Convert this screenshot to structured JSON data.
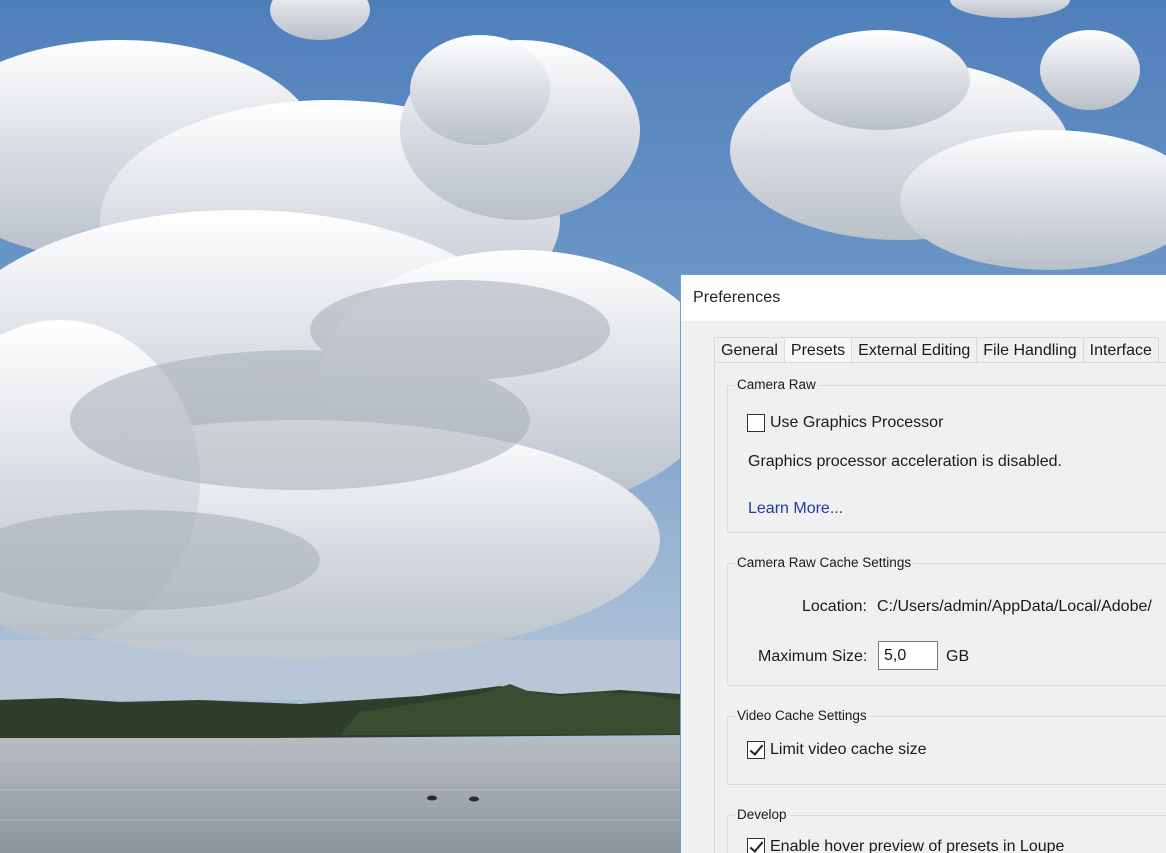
{
  "window": {
    "title": "Preferences"
  },
  "tabs": [
    {
      "label": "General"
    },
    {
      "label": "Presets"
    },
    {
      "label": "External Editing"
    },
    {
      "label": "File Handling"
    },
    {
      "label": "Interface"
    }
  ],
  "camera_raw": {
    "heading": "Camera Raw",
    "use_gpu_label": "Use Graphics Processor",
    "use_gpu_checked": false,
    "status_text": "Graphics processor acceleration is disabled.",
    "learn_more": "Learn More..."
  },
  "cache_settings": {
    "heading": "Camera Raw Cache Settings",
    "location_label": "Location:",
    "location_value": "C:/Users/admin/AppData/Local/Adobe/",
    "max_size_label": "Maximum Size:",
    "max_size_value": "5,0",
    "max_size_unit": "GB"
  },
  "video_cache": {
    "heading": "Video Cache Settings",
    "limit_label": "Limit video cache size",
    "limit_checked": true
  },
  "develop": {
    "heading": "Develop",
    "hover_preview_label": "Enable hover preview of presets in Loupe",
    "hover_preview_checked": true
  },
  "colors": {
    "sky": "#5b86bd",
    "window_border": "#6fa0d2",
    "link": "#1f3aa6"
  }
}
